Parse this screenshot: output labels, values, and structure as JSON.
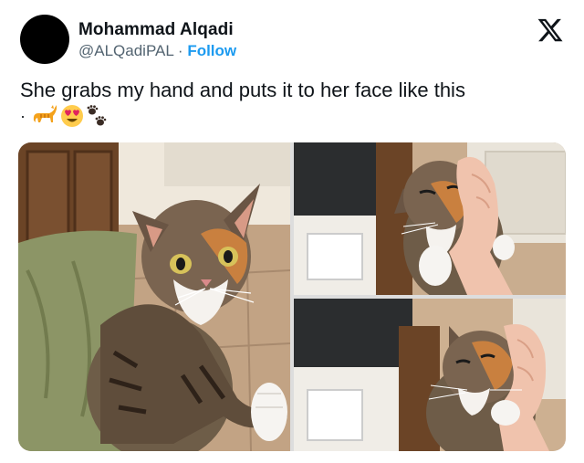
{
  "tweet": {
    "author_name": "Mohammad Alqadi",
    "handle": "@ALQadiPAL",
    "separator": " · ",
    "follow_label": "Follow",
    "text": "She grabs my hand and puts it to her face like this",
    "emoji_prefix": "·",
    "emoji_icons": [
      "cat-icon",
      "heart-eyes-icon",
      "paw-prints-icon"
    ]
  },
  "colors": {
    "link": "#1d9bf0",
    "secondary_text": "#536471",
    "primary_text": "#0f1419"
  }
}
